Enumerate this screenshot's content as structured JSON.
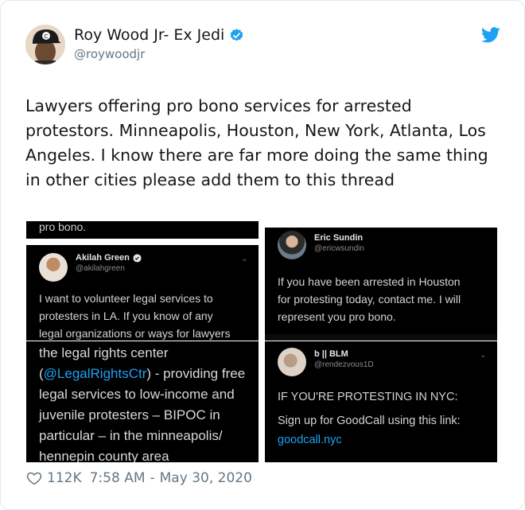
{
  "author": {
    "display_name": "Roy Wood Jr- Ex Jedi",
    "handle": "@roywoodjr",
    "verified_icon": "verified-badge-icon",
    "avatar_cap_letter": "C"
  },
  "tweet": {
    "text": "Lawyers offering pro bono services for arrested protestors. Minneapolis, Houston, New York, Atlanta, Los Angeles. I know there are far more doing the same thing in other cities please add them to this thread"
  },
  "media": {
    "top_left_cropped_text": "pro bono.",
    "akilah": {
      "name": "Akilah Green",
      "handle": "@akilahgreen",
      "body": [
        "I want to volunteer legal services to",
        "protesters in LA. If you know of any",
        "legal organizations or ways for lawyers"
      ]
    },
    "eric": {
      "name": "Eric Sundin",
      "handle": "@ericwsundin",
      "body": [
        "If you have been arrested in Houston",
        "for protesting today, contact me. I will",
        "represent you pro bono."
      ]
    },
    "legal_rights": {
      "line1": "the legal rights center",
      "link": "@LegalRightsCtr",
      "line2_rest": ") - providing free",
      "line2_open": "(",
      "line3": "legal services to low-income and",
      "line4": "juvenile protesters – BIPOC in",
      "line5": "particular – in the minneapolis/",
      "line6": "hennepin county area"
    },
    "blm": {
      "name": "b || BLM",
      "handle": "@rendezvous1D",
      "line1": "IF YOU'RE PROTESTING IN NYC:",
      "line2": "Sign up for GoodCall using this link:",
      "link": "goodcall.nyc"
    }
  },
  "footer": {
    "likes": "112K",
    "time": "7:58 AM",
    "separator": "-",
    "date": "May 30, 2020"
  },
  "colors": {
    "twitter_blue": "#1da1f2",
    "text": "#14171a",
    "muted": "#657786"
  }
}
